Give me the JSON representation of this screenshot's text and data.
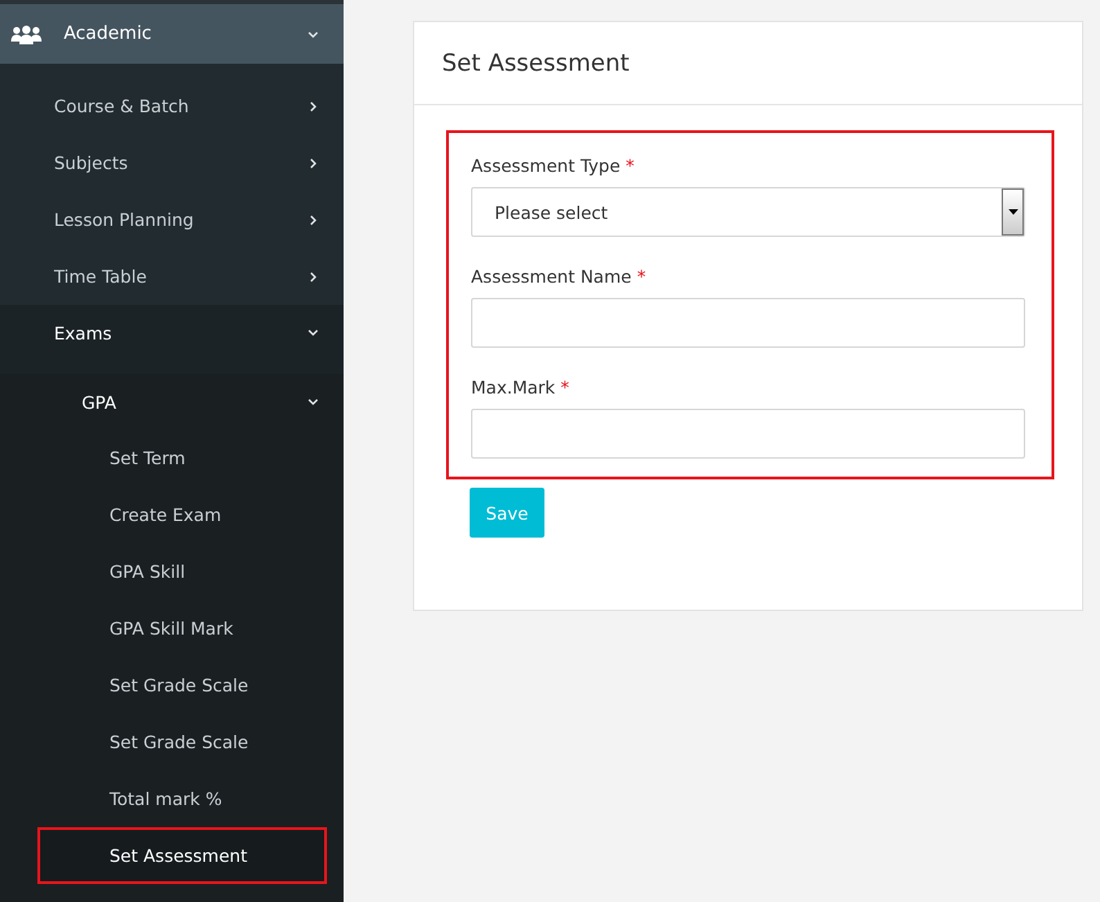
{
  "sidebar": {
    "header": {
      "label": "Academic",
      "expanded": true
    },
    "items": [
      {
        "label": "Course & Batch",
        "expanded": false
      },
      {
        "label": "Subjects",
        "expanded": false
      },
      {
        "label": "Lesson Planning",
        "expanded": false
      },
      {
        "label": "Time Table",
        "expanded": false
      },
      {
        "label": "Exams",
        "expanded": true,
        "children": [
          {
            "label": "GPA",
            "expanded": true,
            "children": [
              {
                "label": "Set Term",
                "selected": false,
                "highlighted": false
              },
              {
                "label": "Create Exam",
                "selected": false,
                "highlighted": false
              },
              {
                "label": "GPA Skill",
                "selected": false,
                "highlighted": false
              },
              {
                "label": "GPA Skill Mark",
                "selected": false,
                "highlighted": false
              },
              {
                "label": "Set Grade Scale",
                "selected": false,
                "highlighted": false
              },
              {
                "label": "Set Grade Scale",
                "selected": false,
                "highlighted": false
              },
              {
                "label": "Total mark %",
                "selected": false,
                "highlighted": false
              },
              {
                "label": "Set Assessment",
                "selected": true,
                "highlighted": true
              }
            ]
          }
        ]
      }
    ]
  },
  "panel": {
    "title": "Set Assessment",
    "highlighted": true,
    "fields": [
      {
        "kind": "select",
        "label": "Assessment Type",
        "required_mark": "*",
        "value": "Please select"
      },
      {
        "kind": "text",
        "label": "Assessment Name",
        "required_mark": "*"
      },
      {
        "kind": "text",
        "label": "Max.Mark",
        "required_mark": "*"
      }
    ],
    "button": "Save"
  }
}
